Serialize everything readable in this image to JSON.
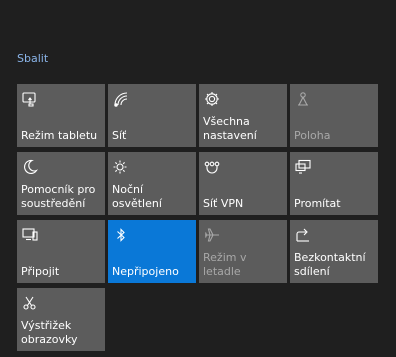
{
  "header": {
    "collapse_label": "Sbalit"
  },
  "tiles": [
    {
      "label": "Režim tabletu",
      "icon": "tablet-mode-icon",
      "state": "normal"
    },
    {
      "label": "Síť",
      "icon": "network-icon",
      "state": "normal"
    },
    {
      "label": "Všechna\nnastavení",
      "icon": "settings-gear-icon",
      "state": "normal"
    },
    {
      "label": "Poloha",
      "icon": "location-icon",
      "state": "disabled"
    },
    {
      "label": "Pomocník pro\nsoustředění",
      "icon": "moon-icon",
      "state": "normal"
    },
    {
      "label": "Noční osvětlení",
      "icon": "night-light-icon",
      "state": "normal"
    },
    {
      "label": "Síť VPN",
      "icon": "vpn-icon",
      "state": "normal"
    },
    {
      "label": "Promítat",
      "icon": "project-icon",
      "state": "normal"
    },
    {
      "label": "Připojit",
      "icon": "connect-icon",
      "state": "normal"
    },
    {
      "label": "Nepřipojeno",
      "icon": "bluetooth-icon",
      "state": "active"
    },
    {
      "label": "Režim v letadle",
      "icon": "airplane-icon",
      "state": "disabled"
    },
    {
      "label": "Bezkontaktní\nsdílení",
      "icon": "nearby-sharing-icon",
      "state": "normal"
    },
    {
      "label": "Výstřižek\nobrazovky",
      "icon": "screen-snip-icon",
      "state": "normal"
    }
  ],
  "colors": {
    "background": "#1f1f1f",
    "tile": "#5c5c5c",
    "tile_active": "#0a78d7",
    "link": "#8ab4e8"
  }
}
